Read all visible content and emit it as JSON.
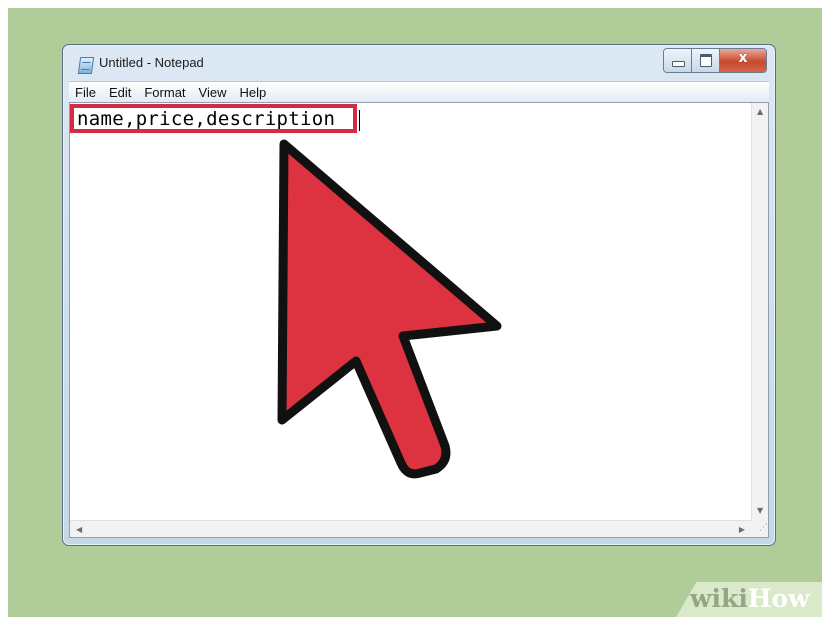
{
  "window": {
    "title": "Untitled - Notepad",
    "icon": "notepad-icon",
    "caption_buttons": {
      "minimize": "minimize-icon",
      "maximize": "maximize-icon",
      "close": "close-icon",
      "close_glyph": "x"
    }
  },
  "menu": {
    "items": [
      {
        "label": "File"
      },
      {
        "label": "Edit"
      },
      {
        "label": "Format"
      },
      {
        "label": "View"
      },
      {
        "label": "Help"
      }
    ]
  },
  "editor": {
    "text": "name,price,description",
    "highlight_color": "#d42a43"
  },
  "scrollbars": {
    "up_arrow": "▲",
    "down_arrow": "▼",
    "left_arrow": "◀",
    "right_arrow": "▶"
  },
  "annotation": {
    "pointer": "mouse-pointer-arrow-icon",
    "color": "#dd3340"
  },
  "watermark": {
    "part1": "wiki",
    "part2": "How"
  }
}
